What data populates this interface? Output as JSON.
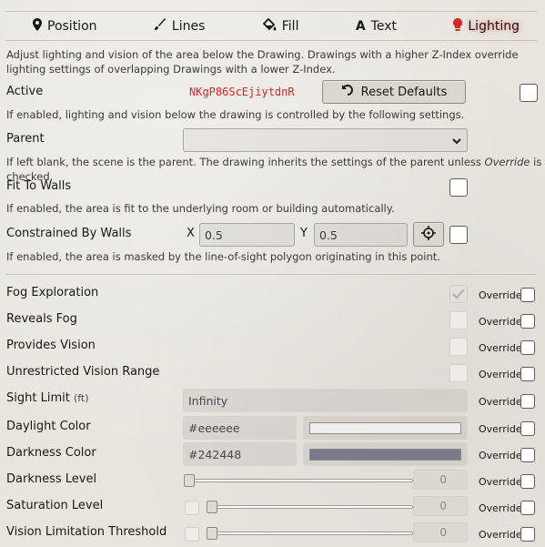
{
  "tabs": [
    {
      "label": "Position",
      "icon": "map-marker-icon"
    },
    {
      "label": "Lines",
      "icon": "paint-brush-icon"
    },
    {
      "label": "Fill",
      "icon": "fill-drip-icon"
    },
    {
      "label": "Text",
      "icon": "font-icon"
    },
    {
      "label": "Lighting",
      "icon": "lightbulb-icon"
    }
  ],
  "intro": "Adjust lighting and vision of the area below the Drawing. Drawings with a higher Z-Index override lighting settings of overlapping Drawings with a lower Z-Index.",
  "active": {
    "label": "Active",
    "id_text": "NKgP86ScEjiytdnR",
    "reset_label": "Reset Defaults",
    "hint": "If enabled, lighting and vision below the drawing is controlled by the following settings."
  },
  "parent": {
    "label": "Parent",
    "value": "",
    "hint_before": "If left blank, the scene is the parent. The drawing inherits the settings of the parent unless ",
    "hint_em": "Override",
    "hint_after": " is checked."
  },
  "fit_to_walls": {
    "label": "Fit To Walls",
    "hint": "If enabled, the area is fit to the underlying room or building automatically."
  },
  "constrained": {
    "label": "Constrained By Walls",
    "x_label": "X",
    "x_value": "0.5",
    "y_label": "Y",
    "y_value": "0.5",
    "hint": "If enabled, the area is masked by the line-of-sight polygon originating in this point."
  },
  "override_label": "Override",
  "rows": {
    "fog_exploration": "Fog Exploration",
    "reveals_fog": "Reveals Fog",
    "provides_vision": "Provides Vision",
    "unrestricted_vision": "Unrestricted Vision Range",
    "sight_limit": "Sight Limit",
    "sight_limit_unit": "(ft)",
    "sight_limit_value": "Infinity",
    "daylight_color": "Daylight Color",
    "daylight_value": "#eeeeee",
    "darkness_color": "Darkness Color",
    "darkness_value": "#242448",
    "darkness_level": "Darkness Level",
    "darkness_level_value": "0",
    "saturation_level": "Saturation Level",
    "saturation_level_value": "0",
    "vision_threshold": "Vision Limitation Threshold",
    "vision_threshold_value": "0"
  },
  "colors": {
    "daylight_swatch": "#eeeeee",
    "darkness_swatch": "#7b7a8d",
    "accent_red": "#d82626"
  }
}
